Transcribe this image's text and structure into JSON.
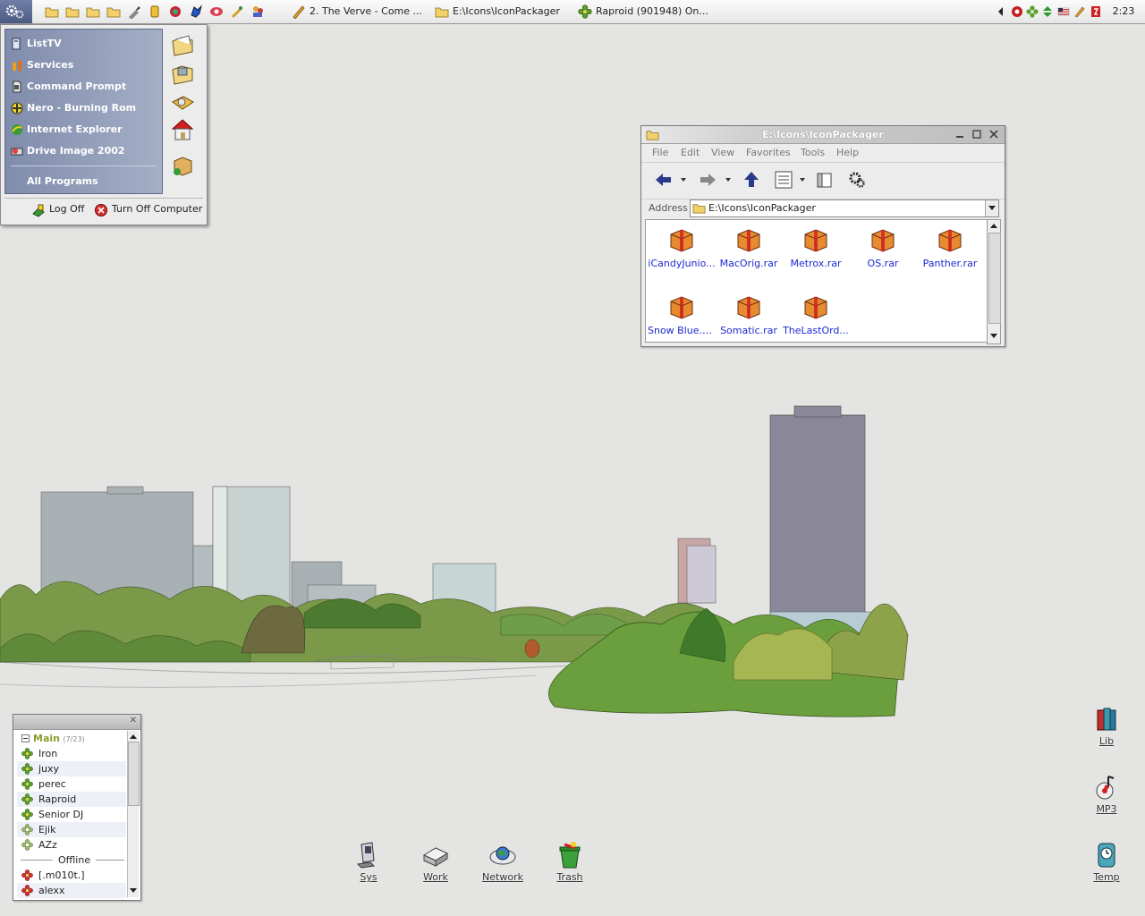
{
  "taskbar": {
    "quick_launch_icons": [
      "folder-icon",
      "folder-icon",
      "folder-icon",
      "folder-icon",
      "brush-icon",
      "battery-icon",
      "recycle-icon",
      "sonic-icon",
      "eye-icon",
      "paint-icon",
      "people-icon"
    ],
    "tasks": [
      {
        "label": "2. The Verve - Come ...",
        "icon": "media-player-icon"
      },
      {
        "label": "E:\\Icons\\IconPackager",
        "icon": "folder-icon"
      },
      {
        "label": "Raproid (901948) On...",
        "icon": "icq-flower-icon"
      }
    ],
    "tray_icons": [
      "tray-arrow-icon",
      "tray-shield-icon",
      "tray-icq-icon",
      "tray-updown-icon",
      "tray-flag-icon",
      "tray-pencil-icon",
      "tray-sound-icon"
    ],
    "clock": "2:23"
  },
  "start_menu": {
    "items": [
      {
        "label": "ListTV",
        "icon": "tv-icon"
      },
      {
        "label": "Services",
        "icon": "services-icon"
      },
      {
        "label": "Command Prompt",
        "icon": "command-prompt-icon"
      },
      {
        "label": "Nero - Burning Rom",
        "icon": "nero-icon"
      },
      {
        "label": "Internet Explorer",
        "icon": "internet-explorer-icon"
      },
      {
        "label": "Drive Image 2002",
        "icon": "drive-image-icon"
      }
    ],
    "all_programs": "All Programs",
    "log_off": "Log Off",
    "turn_off": "Turn Off Computer"
  },
  "explorer": {
    "title": "E:\\Icons\\IconPackager",
    "menu": [
      "File",
      "Edit",
      "View",
      "Favorites",
      "Tools",
      "Help"
    ],
    "address_label": "Address",
    "address": "E:\\Icons\\IconPackager",
    "files": [
      "iCandyJunio...",
      "MacOrig.rar",
      "Metrox.rar",
      "OS.rar",
      "Panther.rar",
      "Snow Blue.rar",
      "Somatic.rar",
      "TheLastOrd..."
    ]
  },
  "buddy_list": {
    "group": "Main",
    "group_count": "(7/23)",
    "online": [
      "Iron",
      "juxy",
      "perec",
      "Raproid",
      "Senior DJ",
      "Ejik",
      "AZz"
    ],
    "offline_label": "Offline",
    "offline": [
      "[.m010t.]",
      "alexx"
    ]
  },
  "desktop_icons": {
    "bottom": [
      "Sys",
      "Work",
      "Network",
      "Trash"
    ],
    "right": [
      "Lib",
      "MP3",
      "Temp"
    ]
  },
  "colors": {
    "desktop": "#e4e4e2",
    "start_menu_panel": "#8b97b6",
    "file_link": "#1c2ad0",
    "buddy_group": "#8aa030"
  }
}
